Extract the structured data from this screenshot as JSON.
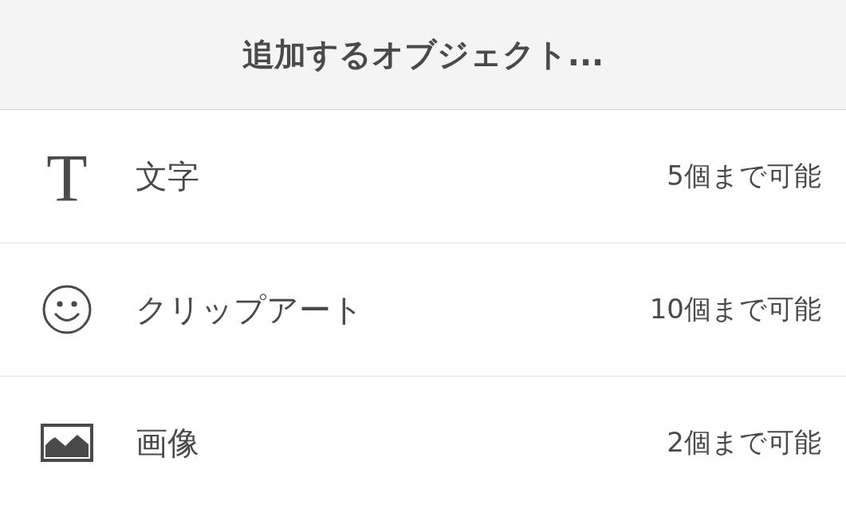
{
  "header": {
    "title": "追加するオブジェクト..."
  },
  "items": [
    {
      "kind": "text",
      "icon": "T",
      "label": "文字",
      "limit": "5個まで可能"
    },
    {
      "kind": "clipart",
      "label": "クリップアート",
      "limit": "10個まで可能"
    },
    {
      "kind": "image",
      "label": "画像",
      "limit": "2個まで可能"
    }
  ]
}
